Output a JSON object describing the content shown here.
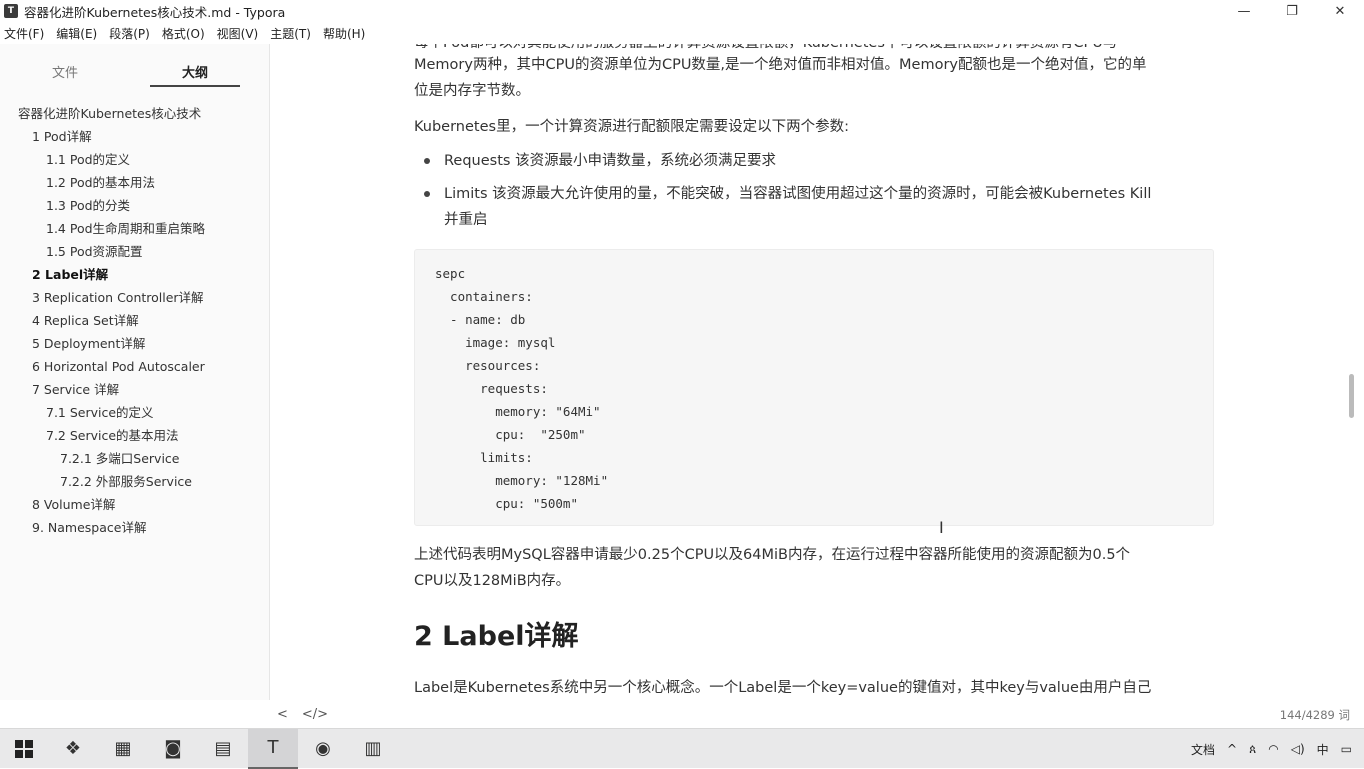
{
  "window": {
    "title": "容器化进阶Kubernetes核心技术.md - Typora",
    "app_icon": "T",
    "minimize": "—",
    "maximize": "❐",
    "close": "✕"
  },
  "menu": [
    "文件(F)",
    "编辑(E)",
    "段落(P)",
    "格式(O)",
    "视图(V)",
    "主题(T)",
    "帮助(H)"
  ],
  "sidebar": {
    "tabs": [
      "文件",
      "大纲"
    ],
    "outline": [
      {
        "label": "容器化进阶Kubernetes核心技术",
        "level": 0
      },
      {
        "label": "1 Pod详解",
        "level": 1
      },
      {
        "label": "1.1 Pod的定义",
        "level": 2
      },
      {
        "label": "1.2 Pod的基本用法",
        "level": 2
      },
      {
        "label": "1.3 Pod的分类",
        "level": 2
      },
      {
        "label": "1.4 Pod生命周期和重启策略",
        "level": 2
      },
      {
        "label": "1.5 Pod资源配置",
        "level": 2
      },
      {
        "label": "2 Label详解",
        "level": 1,
        "bold": true
      },
      {
        "label": "3 Replication Controller详解",
        "level": 1
      },
      {
        "label": "4 Replica Set详解",
        "level": 1
      },
      {
        "label": "5 Deployment详解",
        "level": 1
      },
      {
        "label": "6 Horizontal Pod Autoscaler",
        "level": 1
      },
      {
        "label": "7 Service 详解",
        "level": 1
      },
      {
        "label": "7.1 Service的定义",
        "level": 2
      },
      {
        "label": "7.2 Service的基本用法",
        "level": 2
      },
      {
        "label": "7.2.1 多端口Service",
        "level": 3
      },
      {
        "label": "7.2.2 外部服务Service",
        "level": 3
      },
      {
        "label": "8 Volume详解",
        "level": 1
      },
      {
        "label": "9. Namespace详解",
        "level": 1
      }
    ]
  },
  "content": {
    "para_top_cut": "每个Pod都可以对其能使用的服务器上的计算资源设置限额，Kubernetes中可以设置限额的计算资源有CPU与",
    "para_top_1": "Memory两种，其中CPU的资源单位为CPU数量,是一个绝对值而非相对值。Memory配额也是一个绝对值，它的单",
    "para_top_2": "位是内存字节数。",
    "para_params": "Kubernetes里，一个计算资源进行配额限定需要设定以下两个参数:",
    "bullet_1": "Requests 该资源最小申请数量，系统必须满足要求",
    "bullet_2_line1": "Limits 该资源最大允许使用的量，不能突破，当容器试图使用超过这个量的资源时，可能会被Kubernetes Kill",
    "bullet_2_line2": "并重启",
    "code_lines": [
      "sepc",
      "  containers:",
      "  - name: db",
      "    image: mysql",
      "    resources:",
      "      requests:",
      "        memory: \"64Mi\"",
      "        cpu:  \"250m\"",
      "      limits:",
      "        memory: \"128Mi\"",
      "        cpu: \"500m\""
    ],
    "para_after_1": "上述代码表明MySQL容器申请最少0.25个CPU以及64MiB内存，在运行过程中容器所能使用的资源配额为0.5个",
    "para_after_2": "CPU以及128MiB内存。",
    "heading": "2 Label详解",
    "para_label": "Label是Kubernetes系统中另一个核心概念。一个Label是一个key=value的键值对，其中key与value由用户自己"
  },
  "statusbar": {
    "back": "<",
    "source": "</>",
    "word_count": "144/4289 词"
  },
  "taskbar": {
    "apps": [
      "❖",
      "▦",
      "◙",
      "▤",
      "T",
      "◉",
      "▥"
    ],
    "tray": {
      "label": "文档",
      "chevron": "^",
      "person": "ጰ",
      "net": "◠",
      "volume": "◁)",
      "ime": "中",
      "notify": "▭"
    }
  }
}
